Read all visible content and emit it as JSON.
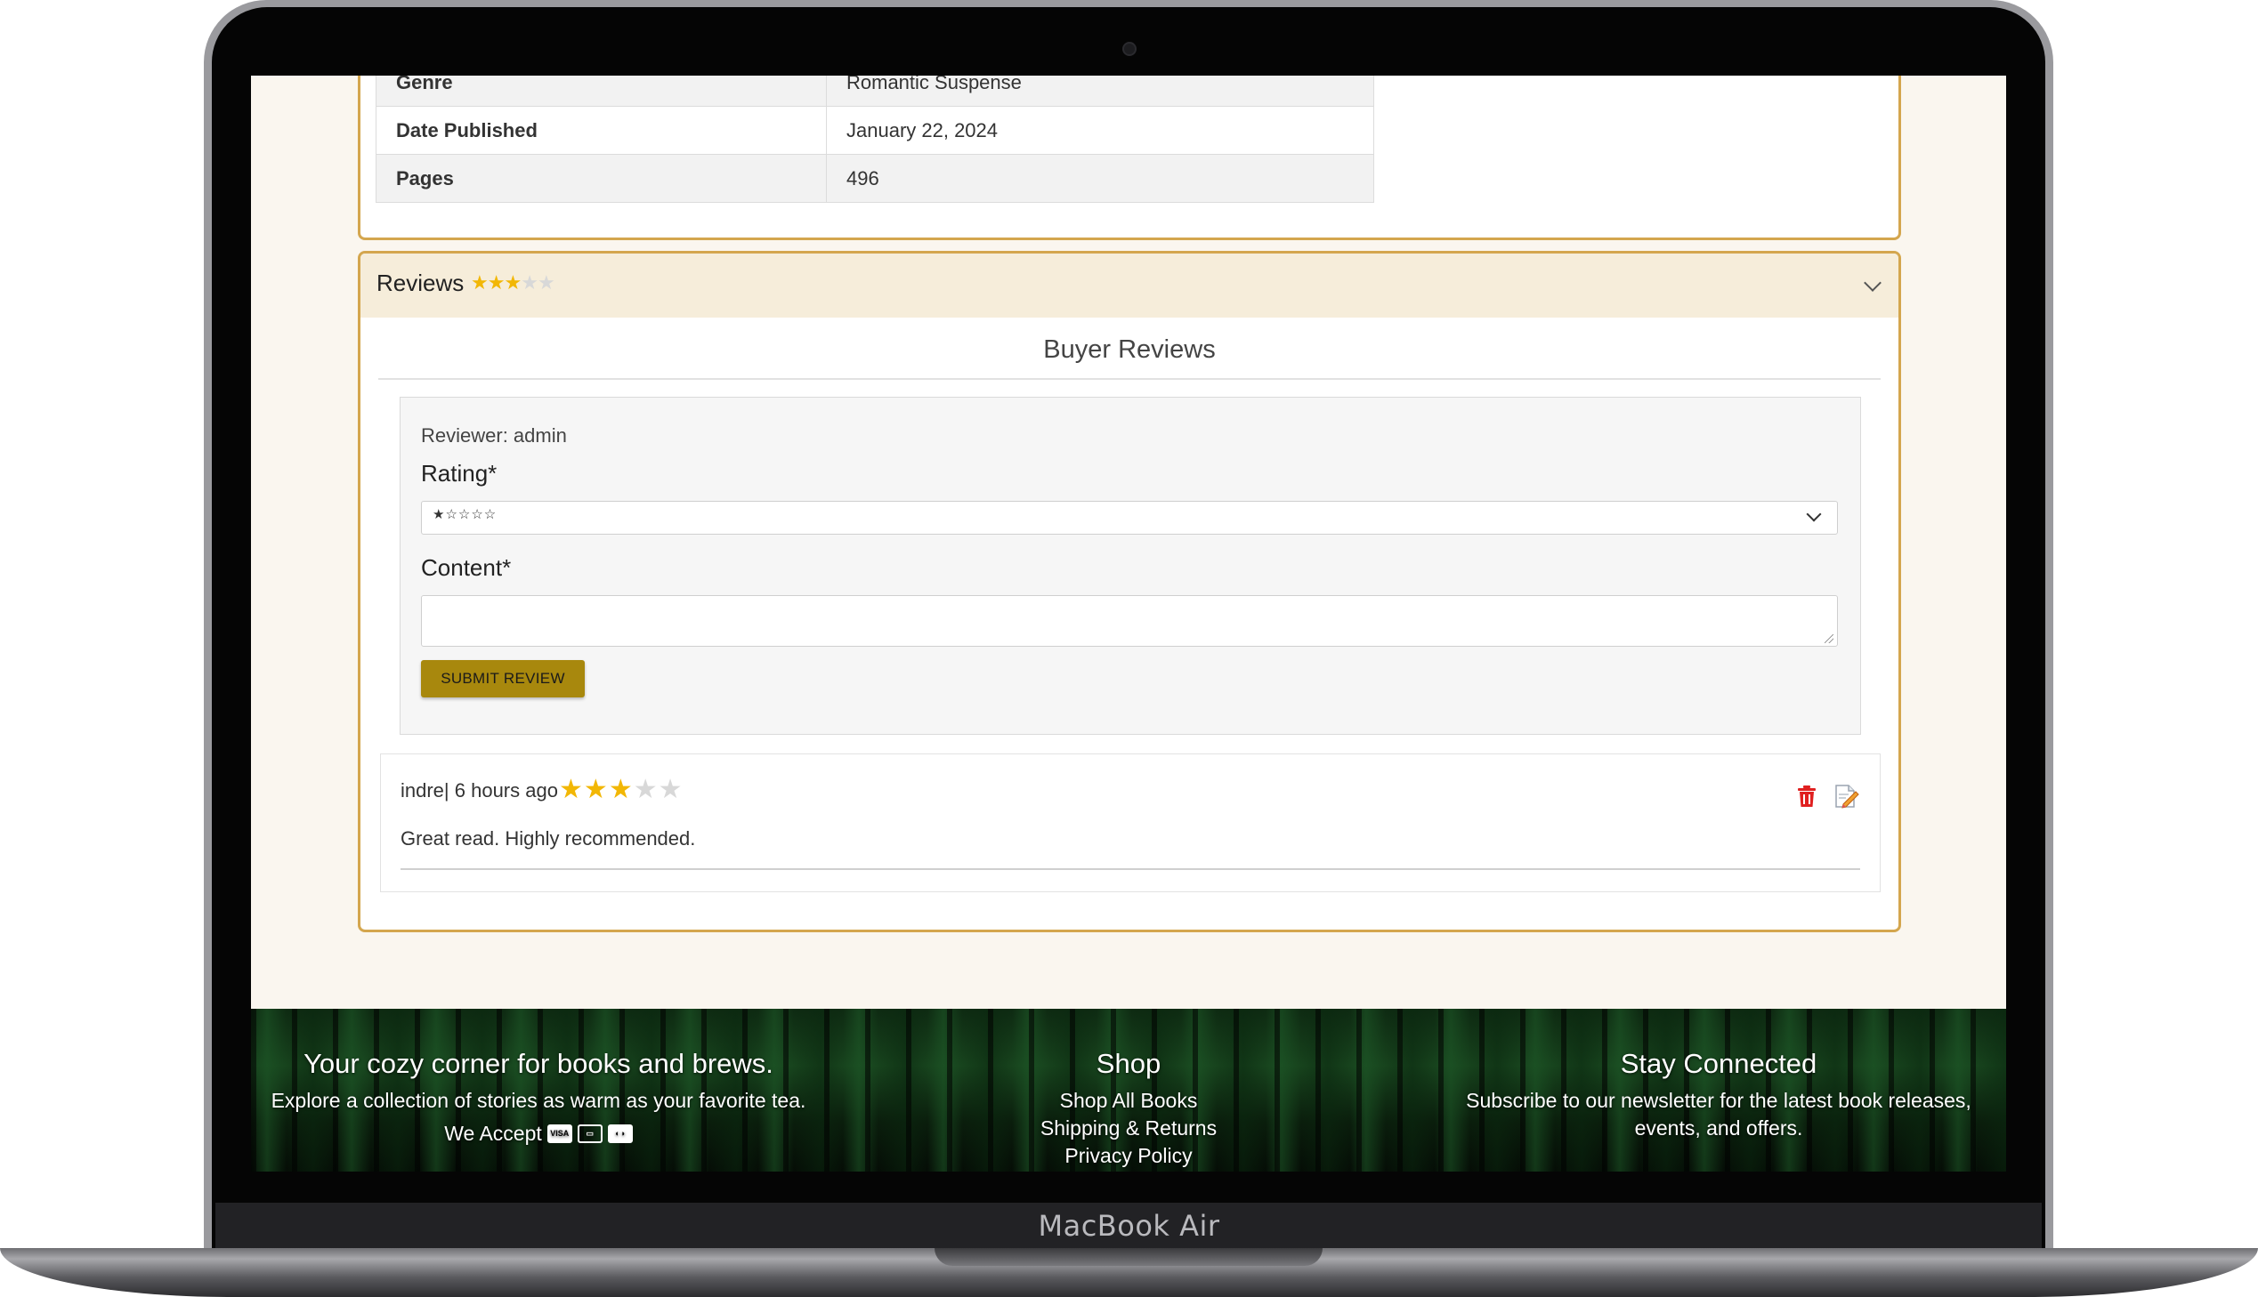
{
  "device": {
    "model_label": "MacBook Air"
  },
  "details_table": {
    "rows": [
      {
        "key": "Genre",
        "value": "Romantic Suspense"
      },
      {
        "key": "Date Published",
        "value": "January 22, 2024"
      },
      {
        "key": "Pages",
        "value": "496"
      }
    ]
  },
  "reviews_section": {
    "header_label": "Reviews",
    "average_rating": 3,
    "max_rating": 5,
    "title": "Buyer Reviews",
    "form": {
      "reviewer_text": "Reviewer: admin",
      "rating_label": "Rating*",
      "rating_selected": "★☆☆☆☆",
      "content_label": "Content*",
      "content_value": "",
      "submit_label": "SUBMIT REVIEW"
    },
    "reviews": [
      {
        "author_line": "indre| 6 hours ago",
        "rating": 3,
        "text": "Great read. Highly recommended."
      }
    ]
  },
  "footer": {
    "col1": {
      "heading": "Your cozy corner for books and brews.",
      "line": "Explore a collection of stories as warm as your favorite tea.",
      "accept_label": "We Accept",
      "cards": [
        "visa-card-icon",
        "credit-card-icon",
        "mastercard-icon"
      ]
    },
    "col2": {
      "heading": "Shop",
      "links": [
        "Shop All Books",
        "Shipping & Returns",
        "Privacy Policy"
      ]
    },
    "col3": {
      "heading": "Stay Connected",
      "line1": "Subscribe to our newsletter for the latest book releases,",
      "line2": "events, and offers."
    }
  },
  "colors": {
    "accent_border": "#d4a64e",
    "submit_button": "#a8880d",
    "star_filled": "#f2b705",
    "star_empty": "#d8d8d8",
    "delete_icon": "#e02020"
  }
}
